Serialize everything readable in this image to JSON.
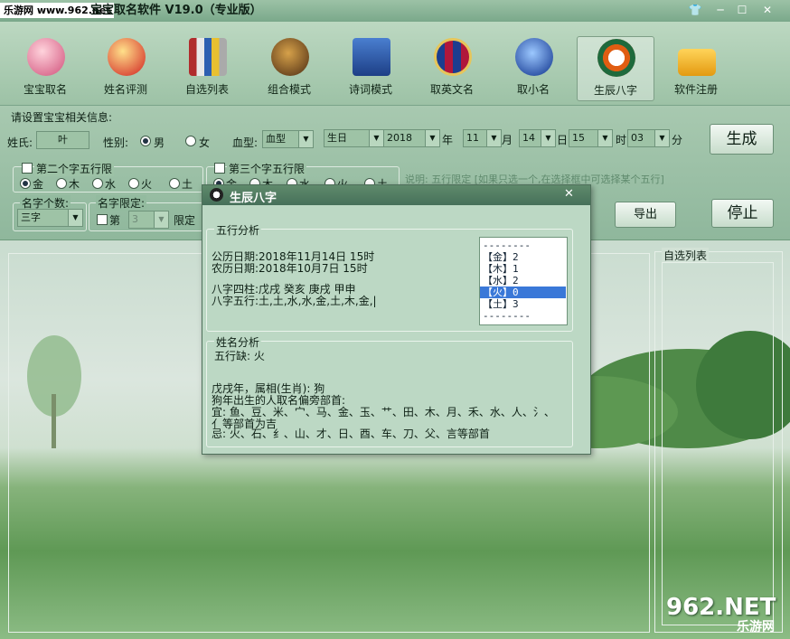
{
  "window": {
    "watermark": "乐游网 www.962.net",
    "title": "宝宝取名软件 V19.0（专业版）"
  },
  "toolbar": [
    {
      "label": "宝宝取名",
      "icon": "baby-icon"
    },
    {
      "label": "姓名评测",
      "icon": "fortune-icon"
    },
    {
      "label": "自选列表",
      "icon": "brushes-icon"
    },
    {
      "label": "组合模式",
      "icon": "lion-icon"
    },
    {
      "label": "诗词模式",
      "icon": "book-icon"
    },
    {
      "label": "取英文名",
      "icon": "shield-icon"
    },
    {
      "label": "取小名",
      "icon": "bird-icon"
    },
    {
      "label": "生辰八字",
      "icon": "bagua-icon"
    },
    {
      "label": "软件注册",
      "icon": "lock-icon"
    }
  ],
  "settings": {
    "heading": "请设置宝宝相关信息:",
    "surname_label": "姓氏:",
    "surname_value": "叶",
    "gender_label": "性别:",
    "male": "男",
    "female": "女",
    "blood_label": "血型:",
    "blood_value": "血型",
    "birthday_value": "生日",
    "year": "2018",
    "year_unit": "年",
    "month": "11",
    "month_unit": "月",
    "day": "14",
    "day_unit": "日",
    "hour": "15",
    "hour_unit": "时",
    "minute": "03",
    "minute_unit": "分",
    "generate": "生成",
    "export": "导出",
    "stop": "停止",
    "second_char_label": "第二个字五行限",
    "third_char_label": "第三个字五行限",
    "elements": [
      "金",
      "木",
      "水",
      "火",
      "土"
    ],
    "count_label": "名字个数:",
    "count_value": "三字",
    "limit_label": "名字限定:",
    "limit_nth": "第",
    "limit_value": "3",
    "limit_suffix": "限定",
    "hint": "说明: 五行限定 [如果只选一个,在选择框中可选择某个五行]"
  },
  "selection_list": {
    "title": "自选列表"
  },
  "dialog": {
    "title": "生辰八字",
    "close": "✕",
    "wuxing_group": "五行分析",
    "solar": "公历日期:2018年11月14日 15时",
    "lunar": "农历日期:2018年10月7日 15时",
    "bazi": "八字四柱:戊戌 癸亥 庚戌 甲申",
    "bazi_wuxing": "八字五行:土,土,水,水,金,土,木,金,|",
    "list": [
      {
        "text": "--------"
      },
      {
        "text": "【金】2"
      },
      {
        "text": "【木】1"
      },
      {
        "text": "【水】2"
      },
      {
        "text": "【火】0"
      },
      {
        "text": "【土】3"
      },
      {
        "text": "--------"
      }
    ],
    "name_group": "姓名分析",
    "lack": "五行缺: 火",
    "zodiac": "戊戌年，属相(生肖): 狗",
    "advice_title": "狗年出生的人取名偏旁部首:",
    "good": "宜: 鱼、豆、米、宀、马、金、玉、艹、田、木、月、禾、水、人、氵、",
    "good2": "亻等部首为吉",
    "bad": "忌: 火、石、纟、山、才、日、酉、车、刀、父、言等部首"
  },
  "brand": {
    "logo": "962.NET",
    "sub": "乐游网"
  }
}
